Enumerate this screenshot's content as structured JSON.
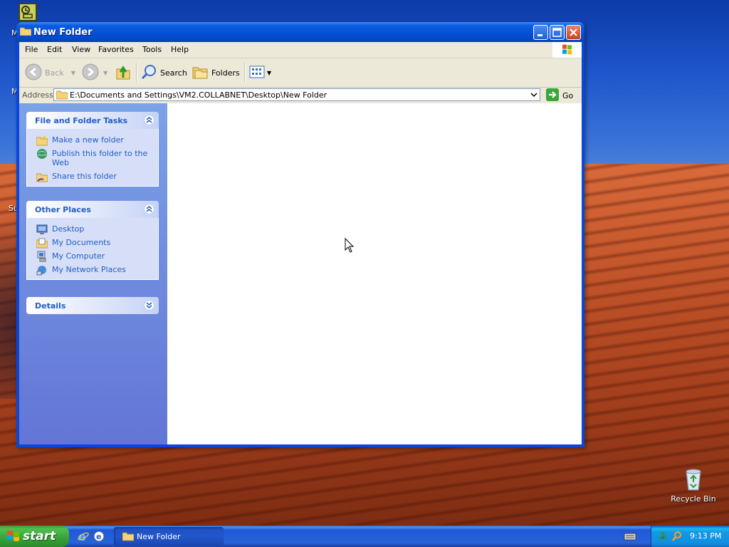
{
  "window": {
    "title": "New Folder",
    "buttons": {
      "minimize": "_",
      "maximize": "□",
      "close": "✕"
    }
  },
  "menubar": [
    "File",
    "Edit",
    "View",
    "Favorites",
    "Tools",
    "Help"
  ],
  "toolbar": {
    "back": "Back",
    "search": "Search",
    "folders": "Folders"
  },
  "addressbar": {
    "label": "Address",
    "path": "E:\\Documents and Settings\\VM2.COLLABNET\\Desktop\\New Folder",
    "go": "Go"
  },
  "taskpane": {
    "file_tasks": {
      "title": "File and Folder Tasks",
      "items": [
        "Make a new folder",
        "Publish this folder to the Web",
        "Share this folder"
      ]
    },
    "other_places": {
      "title": "Other Places",
      "items": [
        "Desktop",
        "My Documents",
        "My Computer",
        "My Network Places"
      ]
    },
    "details": {
      "title": "Details"
    }
  },
  "desktop": {
    "recycle_bin": "Recycle Bin",
    "left_stubs": [
      "M",
      "M",
      "Su"
    ]
  },
  "taskbar": {
    "start": "start",
    "task": "New Folder",
    "clock": "9:13 PM"
  },
  "colors": {
    "title_blue": "#0a5ce0",
    "link_blue": "#215dc6",
    "start_green": "#3ca53c"
  },
  "icons": [
    "folder-icon",
    "back-arrow-icon",
    "forward-arrow-icon",
    "up-folder-icon",
    "search-icon",
    "folders-icon",
    "views-icon",
    "go-arrow-icon",
    "recycle-bin-icon",
    "windows-logo-icon"
  ]
}
